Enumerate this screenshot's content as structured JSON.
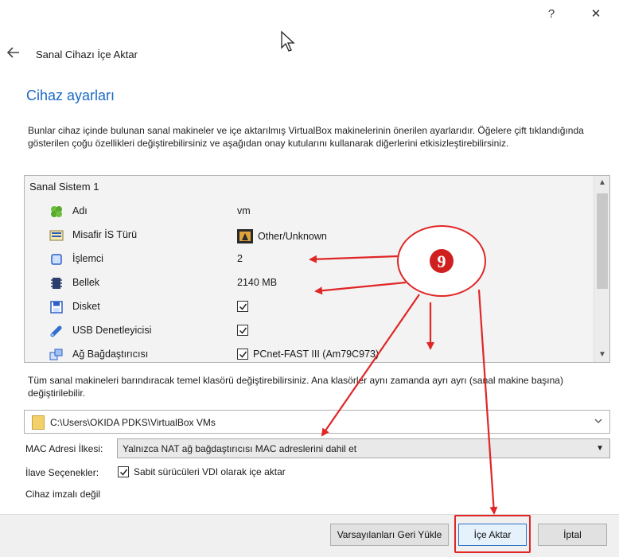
{
  "window": {
    "help_label": "?",
    "close_label": "✕"
  },
  "header": {
    "title": "Sanal Cihazı İçe Aktar"
  },
  "section": {
    "title": "Cihaz ayarları",
    "description": "Bunlar cihaz içinde bulunan sanal makineler ve içe aktarılmış VirtualBox makinelerinin önerilen ayarlarıdır. Öğelere çift tıklandığında gösterilen çoğu özellikleri değiştirebilirsiniz ve aşağıdan onay kutularını kullanarak diğerlerini etkisizleştirebilirsiniz."
  },
  "system": {
    "group": "Sanal Sistem 1",
    "rows": [
      {
        "label": "Adı",
        "value": "vm",
        "icon": "name-icon",
        "checked": false
      },
      {
        "label": "Misafir İS Türü",
        "value": "Other/Unknown",
        "icon": "os-type-icon",
        "checked": false
      },
      {
        "label": "İşlemci",
        "value": "2",
        "icon": "cpu-icon",
        "checked": false
      },
      {
        "label": "Bellek",
        "value": "2140 MB",
        "icon": "memory-icon",
        "checked": false
      },
      {
        "label": "Disket",
        "value": "",
        "icon": "floppy-icon",
        "checked": true
      },
      {
        "label": "USB Denetleyicisi",
        "value": "",
        "icon": "usb-icon",
        "checked": true
      },
      {
        "label": "Ağ Bağdaştırıcısı",
        "value": "PCnet-FAST III (Am79C973)",
        "icon": "network-icon",
        "checked": true
      }
    ]
  },
  "folder": {
    "note": "Tüm sanal makineleri barındıracak temel klasörü değiştirebilirsiniz. Ana klasörler aynı zamanda ayrı ayrı (sanal makine başına) değiştirilebilir.",
    "path": "C:\\Users\\OKIDA PDKS\\VirtualBox VMs"
  },
  "mac": {
    "label": "MAC Adresi İlkesi:",
    "value": "Yalnızca NAT ağ bağdaştırıcısı MAC adreslerini dahil et"
  },
  "extra": {
    "label": "İlave Seçenekler:",
    "checkbox_label": "Sabit sürücüleri VDI olarak içe aktar",
    "checked": true
  },
  "signature": {
    "status": "Cihaz imzalı değil"
  },
  "buttons": {
    "restore": "Varsayılanları Geri Yükle",
    "import": "İçe Aktar",
    "cancel": "İptal"
  },
  "annotation": {
    "number": "9",
    "color": "#e02626"
  }
}
